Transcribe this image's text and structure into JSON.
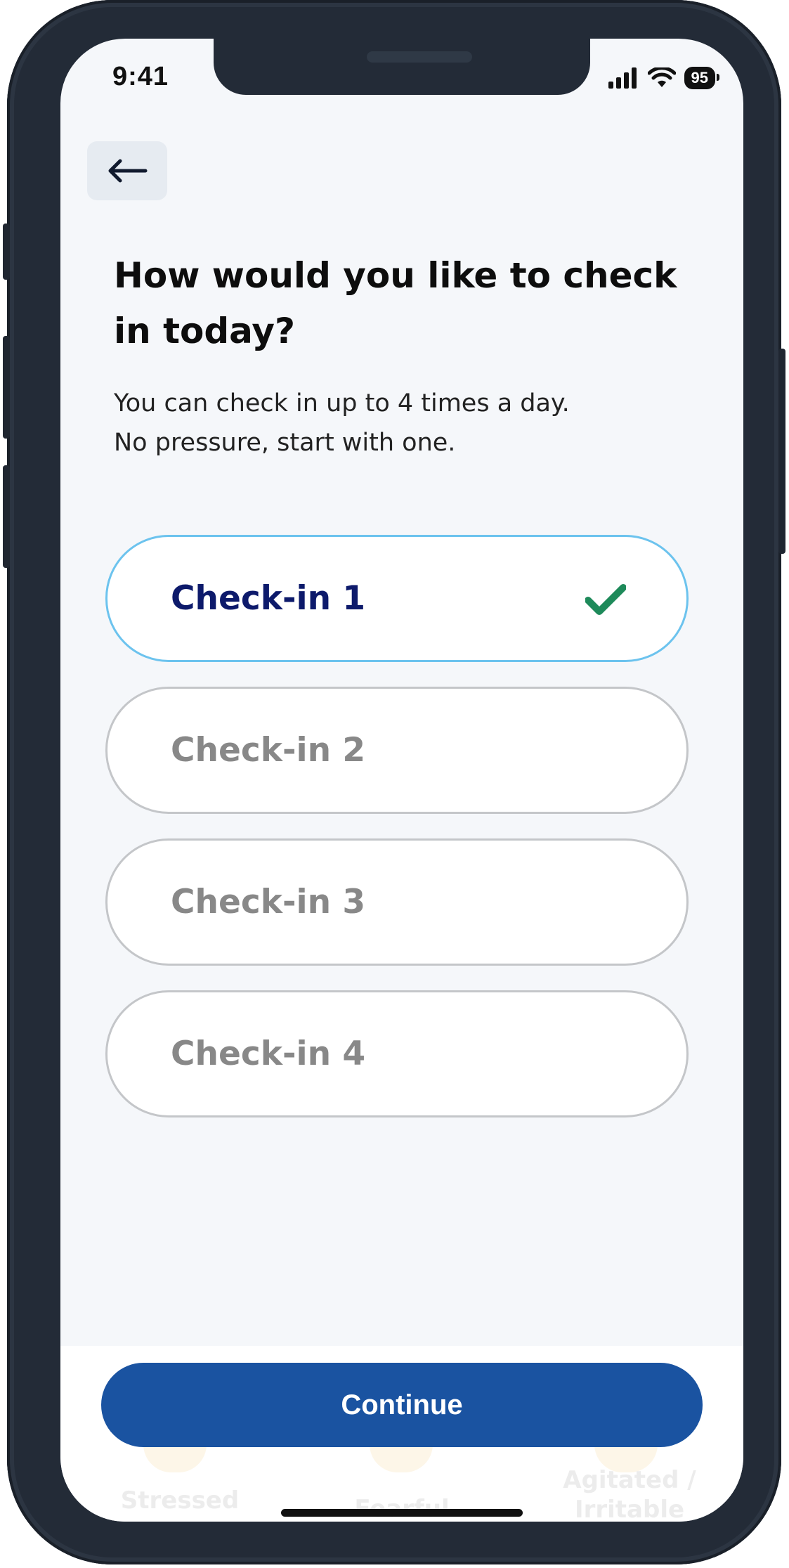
{
  "status_bar": {
    "time": "9:41",
    "battery": "95",
    "icons": [
      "signal-icon",
      "wifi-icon",
      "battery-icon"
    ]
  },
  "header": {
    "back_icon": "arrow-left-icon"
  },
  "main": {
    "title": "How would you like to check in today?",
    "subtitle_line1": "You can check in up to 4 times a day.",
    "subtitle_line2": "No pressure, start with one.",
    "options": [
      {
        "label": "Check-in 1",
        "selected": true
      },
      {
        "label": "Check-in 2",
        "selected": false
      },
      {
        "label": "Check-in 3",
        "selected": false
      },
      {
        "label": "Check-in 4",
        "selected": false
      }
    ]
  },
  "footer": {
    "continue_label": "Continue",
    "background_labels": [
      "Stressed",
      "Fearful",
      "Agitated / Irritable"
    ]
  },
  "colors": {
    "primary": "#1a53a1",
    "selected_border": "#6cc3ee",
    "selected_text": "#0d1a6b",
    "check": "#1e8a5a",
    "unselected_text": "#888888"
  }
}
